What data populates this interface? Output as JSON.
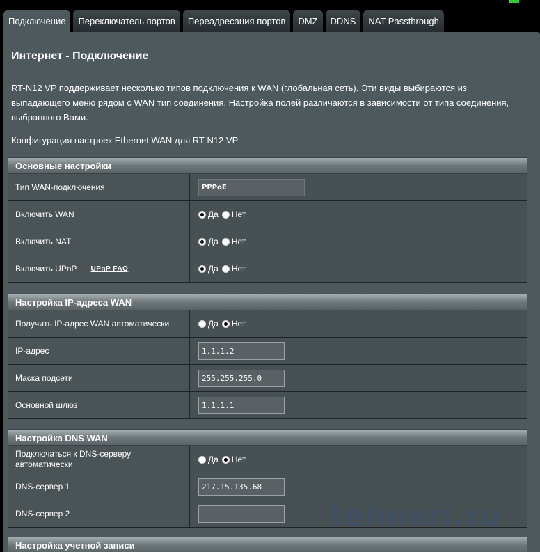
{
  "tabs": [
    {
      "label": "Подключение",
      "active": true
    },
    {
      "label": "Переключатель портов",
      "active": false
    },
    {
      "label": "Переадресация портов",
      "active": false
    },
    {
      "label": "DMZ",
      "active": false
    },
    {
      "label": "DDNS",
      "active": false
    },
    {
      "label": "NAT Passthrough",
      "active": false
    }
  ],
  "page": {
    "title": "Интернет - Подключение",
    "description": "RT-N12 VP поддерживает несколько типов подключения к WAN (глобальная сеть). Эти виды выбираются из выпадающего меню рядом с WAN тип соединения. Настройка полей различаются в зависимости от типа соединения, выбранного Вами.",
    "config_note": "Конфигурация настроек Ethernet WAN для RT-N12 VP"
  },
  "radio_labels": {
    "yes": "Да",
    "no": "Нет"
  },
  "basic": {
    "header": "Основные настройки",
    "wan_type_label": "Тип WAN-подключения",
    "wan_type_value": "PPPoE",
    "enable_wan_label": "Включить WAN",
    "enable_wan": "yes",
    "enable_nat_label": "Включить NAT",
    "enable_nat": "yes",
    "enable_upnp_label": "Включить UPnP",
    "upnp_faq_link": "UPnP FAQ",
    "enable_upnp": "yes"
  },
  "ip": {
    "header": "Настройка IP-адреса WAN",
    "auto_ip_label": "Получить IP-адрес WAN автоматически",
    "auto_ip": "no",
    "ip_label": "IP-адрес",
    "ip_value": "1.1.1.2",
    "mask_label": "Маска подсети",
    "mask_value": "255.255.255.0",
    "gateway_label": "Основной шлюз",
    "gateway_value": "1.1.1.1"
  },
  "dns": {
    "header": "Настройка DNS WAN",
    "auto_dns_label": "Подключаться к DNS-серверу автоматически",
    "auto_dns": "no",
    "dns1_label": "DNS-сервер 1",
    "dns1_value": "217.15.135.68",
    "dns2_label": "DNS-сервер 2",
    "dns2_value": ""
  },
  "account": {
    "header": "Настройка учетной записи"
  },
  "watermark": "tehnari.ru",
  "colors": {
    "accent": "#33cc33",
    "panel": "#4d595c"
  }
}
